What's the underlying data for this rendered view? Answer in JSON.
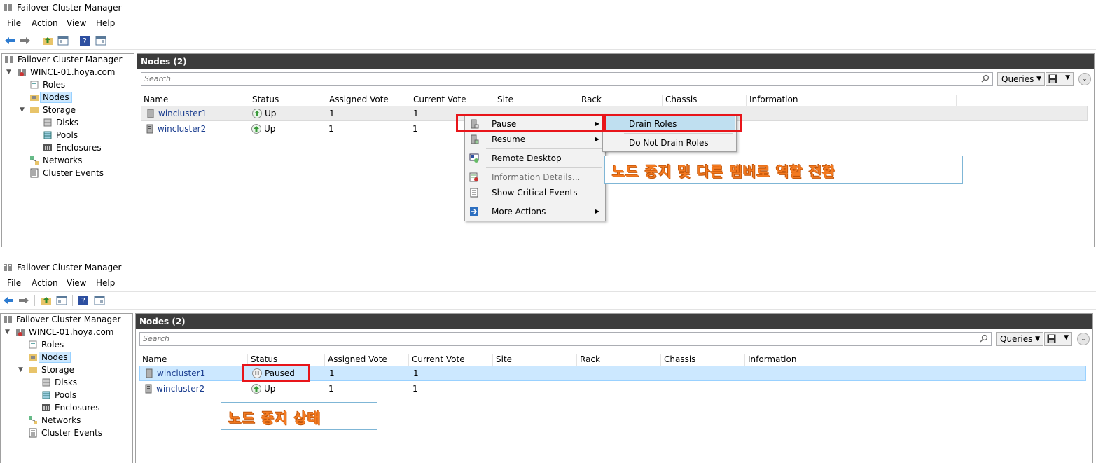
{
  "top": {
    "title": "Failover Cluster Manager",
    "menu": [
      "File",
      "Action",
      "View",
      "Help"
    ],
    "tree": {
      "root": "Failover Cluster Manager",
      "cluster": "WINCL-01.hoya.com",
      "roles": "Roles",
      "nodes": "Nodes",
      "storage": "Storage",
      "disks": "Disks",
      "pools": "Pools",
      "enclosures": "Enclosures",
      "networks": "Networks",
      "events": "Cluster Events"
    },
    "main": {
      "header": "Nodes (2)",
      "search_placeholder": "Search",
      "queries_label": "Queries",
      "columns": [
        "Name",
        "Status",
        "Assigned Vote",
        "Current Vote",
        "Site",
        "Rack",
        "Chassis",
        "Information"
      ],
      "rows": [
        {
          "name": "wincluster1",
          "status": "Up",
          "assigned": "1",
          "current": "1"
        },
        {
          "name": "wincluster2",
          "status": "Up",
          "assigned": "1",
          "current": "1"
        }
      ]
    },
    "context_menu": {
      "items": [
        "Pause",
        "Resume",
        "Remote Desktop",
        "Information Details...",
        "Show Critical Events",
        "More Actions"
      ]
    },
    "submenu": {
      "items": [
        "Drain Roles",
        "Do Not Drain Roles"
      ]
    },
    "callout": "노드 중지 및 다른 멤버로 역할 전환"
  },
  "bottom": {
    "title": "Failover Cluster Manager",
    "menu": [
      "File",
      "Action",
      "View",
      "Help"
    ],
    "tree": {
      "root": "Failover Cluster Manager",
      "cluster": "WINCL-01.hoya.com",
      "roles": "Roles",
      "nodes": "Nodes",
      "storage": "Storage",
      "disks": "Disks",
      "pools": "Pools",
      "enclosures": "Enclosures",
      "networks": "Networks",
      "events": "Cluster Events"
    },
    "main": {
      "header": "Nodes (2)",
      "search_placeholder": "Search",
      "queries_label": "Queries",
      "columns": [
        "Name",
        "Status",
        "Assigned Vote",
        "Current Vote",
        "Site",
        "Rack",
        "Chassis",
        "Information"
      ],
      "rows": [
        {
          "name": "wincluster1",
          "status": "Paused",
          "assigned": "1",
          "current": "1"
        },
        {
          "name": "wincluster2",
          "status": "Up",
          "assigned": "1",
          "current": "1"
        }
      ]
    },
    "callout": "노드 중지 상태"
  },
  "colors": {
    "header_bg": "#3c3c3c",
    "selection": "#cce8ff",
    "highlight_red": "#e8151a",
    "callout_text": "#f47a20",
    "status_up": "#3a9a3a"
  },
  "icons": [
    "cluster-manager-icon",
    "back-arrow-icon",
    "forward-arrow-icon",
    "up-folder-icon",
    "show-hide-tree-icon",
    "help-icon",
    "show-hide-action-pane-icon",
    "search-icon",
    "save-icon",
    "collapse-icon",
    "server-node-icon",
    "status-up-icon",
    "status-paused-icon",
    "remote-desktop-icon",
    "information-details-icon",
    "critical-events-icon",
    "more-actions-icon"
  ]
}
